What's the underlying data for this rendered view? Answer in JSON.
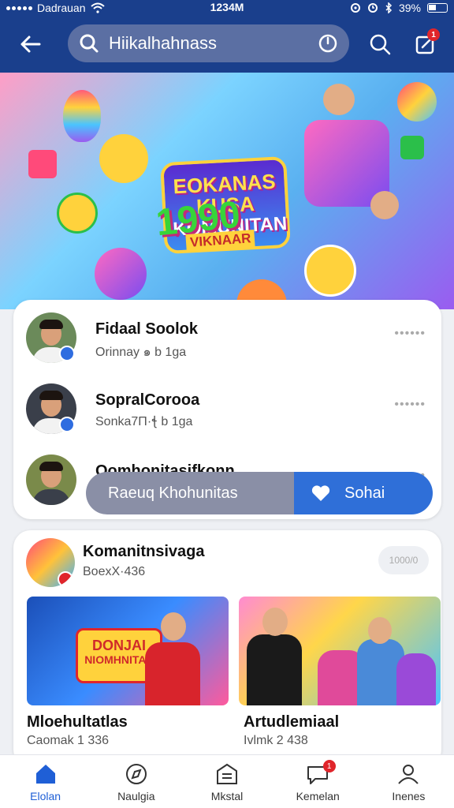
{
  "status_bar": {
    "carrier": "Dadrauan",
    "time": "1234M",
    "battery": "39%"
  },
  "header": {
    "search_query": "Hiikalhahnass",
    "notif_count": "1",
    "icons": [
      "back-arrow-icon",
      "search-icon",
      "power-icon",
      "magnifier-icon",
      "compose-icon"
    ]
  },
  "banner": {
    "title_line1": "EOKANAS",
    "title_line2": "KUSA",
    "title_line3": "KOMUNITAN",
    "year": "1990",
    "subtitle": "VIKNAAR"
  },
  "friends": [
    {
      "name": "Fidaal Soolok",
      "meta": "Orinnay   ๑   b 1ɡa",
      "more": "••••••"
    },
    {
      "name": "SopralCorooa",
      "meta": "Sonka7Π·ꞎ   b 1ɡa",
      "more": "••••••"
    },
    {
      "name": "Oomhonitasifkonn",
      "meta": "",
      "more": "••••••"
    }
  ],
  "join_bar": {
    "left_label": "Raeuq Khohunitas",
    "right_label": "Sohai"
  },
  "group": {
    "name": "Komanitnsivaga",
    "meta": "BoexX·436",
    "pill": "1000/0",
    "tiles": [
      {
        "title": "Mloehultatlas",
        "meta": "Caomak 1 336",
        "sign_line1": "DONJAI",
        "sign_line2": "NIOMHNITAS"
      },
      {
        "title": "Artudlemiaal",
        "meta": "Ivlmk 2 438"
      }
    ]
  },
  "bottom_nav": {
    "items": [
      {
        "label": "Elolan",
        "icon": "home-icon",
        "active": true
      },
      {
        "label": "Naulgia",
        "icon": "compass-icon",
        "active": false
      },
      {
        "label": "Mkstal",
        "icon": "building-icon",
        "active": false
      },
      {
        "label": "Kemelan",
        "icon": "chat-icon",
        "active": false,
        "badge": "1"
      },
      {
        "label": "Inenes",
        "icon": "profile-icon",
        "active": false
      }
    ]
  },
  "colors": {
    "header": "#1a3f8c",
    "accent": "#2f6fd8",
    "badge": "#e0252b",
    "active_nav": "#1f5fd6"
  }
}
